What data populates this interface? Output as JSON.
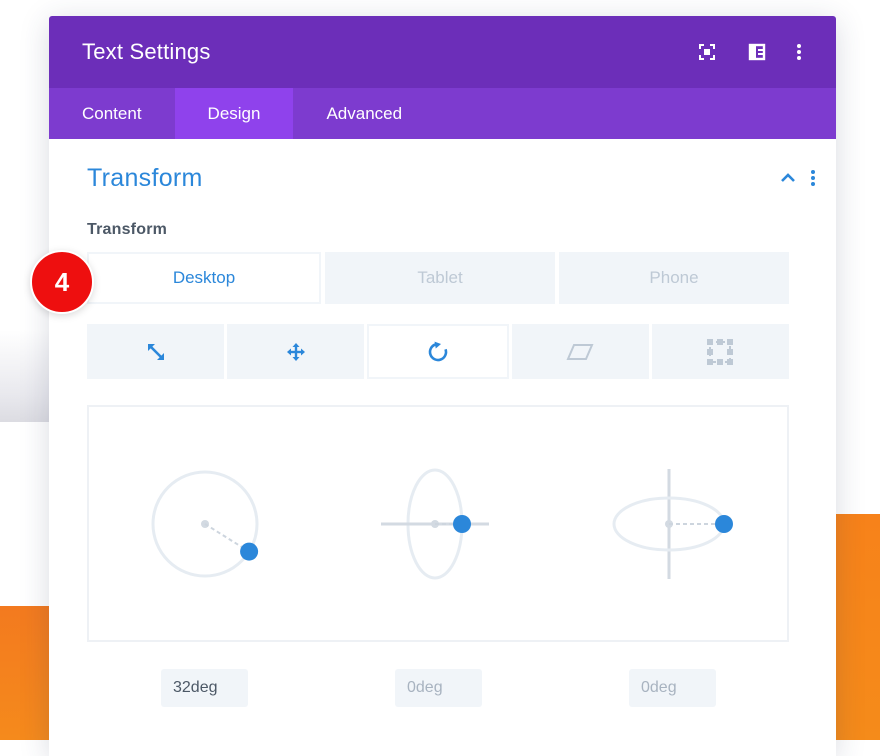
{
  "modal": {
    "title": "Text Settings",
    "header_icons": [
      "focus-icon",
      "split-view-icon",
      "more-vertical-icon"
    ],
    "tabs": [
      {
        "label": "Content",
        "active": false
      },
      {
        "label": "Design",
        "active": true
      },
      {
        "label": "Advanced",
        "active": false
      }
    ]
  },
  "section": {
    "title": "Transform",
    "expanded": true,
    "field_label": "Transform"
  },
  "device_tabs": [
    {
      "label": "Desktop",
      "active": true
    },
    {
      "label": "Tablet",
      "active": false
    },
    {
      "label": "Phone",
      "active": false
    }
  ],
  "transform_tabs": [
    {
      "name": "scale",
      "icon": "scale-arrow-icon",
      "active": false
    },
    {
      "name": "translate",
      "icon": "move-arrows-icon",
      "active": false
    },
    {
      "name": "rotate",
      "icon": "rotate-icon",
      "active": true
    },
    {
      "name": "skew",
      "icon": "skew-parallelogram-icon",
      "active": false
    },
    {
      "name": "origin",
      "icon": "origin-square-icon",
      "active": false
    }
  ],
  "rotate": {
    "z": {
      "value": "32deg",
      "degrees": 32
    },
    "x": {
      "value": "0deg",
      "degrees": 0
    },
    "y": {
      "value": "0deg",
      "degrees": 0
    }
  },
  "step_badge": {
    "number": "4"
  },
  "colors": {
    "header": "#6c2eb9",
    "tabs_bar": "#7d3bcf",
    "active_tab": "#8f42ec",
    "accent": "#2b87da",
    "badge": "#ee0f0f"
  }
}
